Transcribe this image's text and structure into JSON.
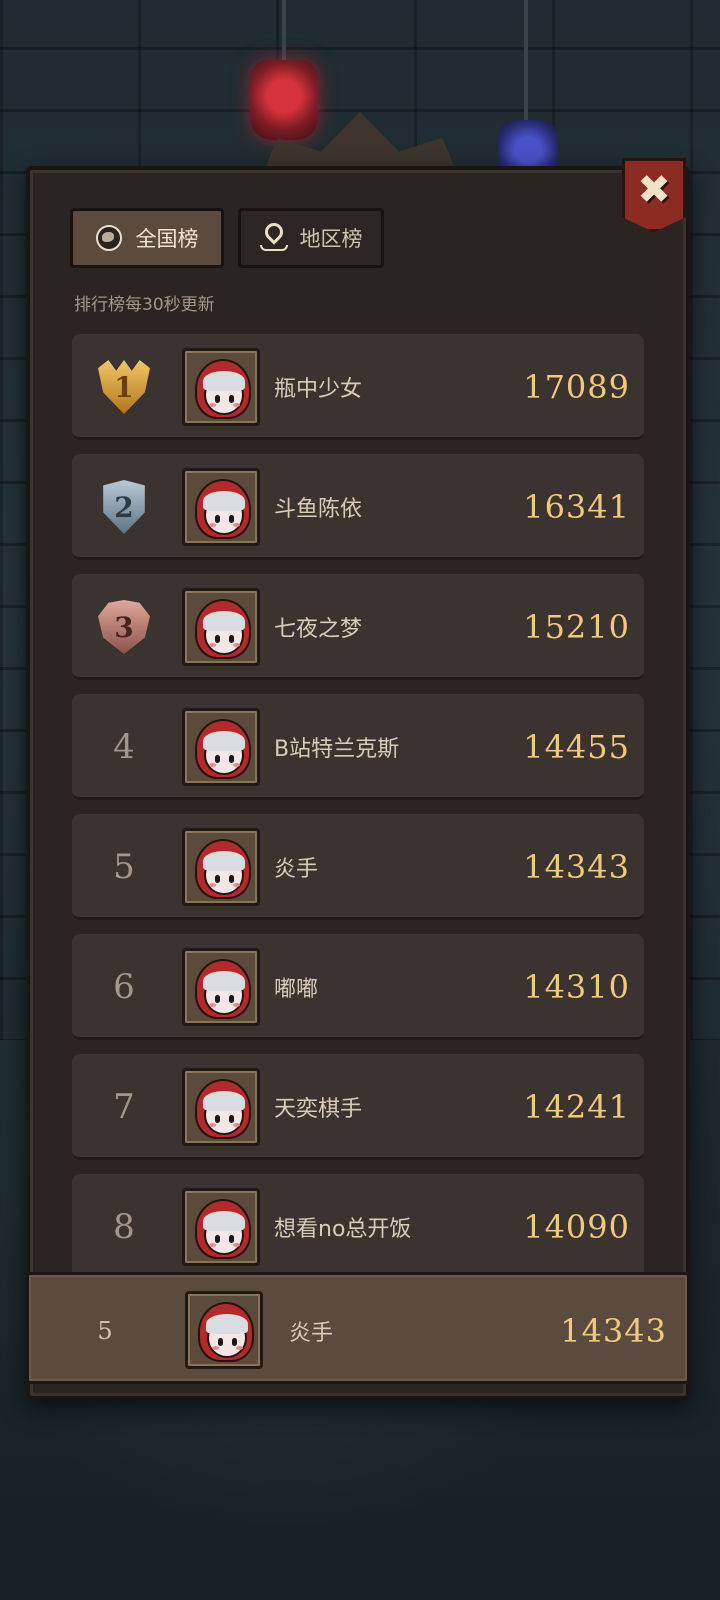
{
  "tabs": {
    "national": "全国榜",
    "region": "地区榜"
  },
  "refresh_note": "排行榜每30秒更新",
  "close_icon": "✖",
  "leaderboard": [
    {
      "rank": "1",
      "name": "瓶中少女",
      "score": "17089",
      "medal": "gold"
    },
    {
      "rank": "2",
      "name": "斗鱼陈依",
      "score": "16341",
      "medal": "silver"
    },
    {
      "rank": "3",
      "name": "七夜之梦",
      "score": "15210",
      "medal": "bronze"
    },
    {
      "rank": "4",
      "name": "B站特兰克斯",
      "score": "14455"
    },
    {
      "rank": "5",
      "name": "炎手",
      "score": "14343"
    },
    {
      "rank": "6",
      "name": "嘟嘟",
      "score": "14310"
    },
    {
      "rank": "7",
      "name": "天奕棋手",
      "score": "14241"
    },
    {
      "rank": "8",
      "name": "想看no总开饭",
      "score": "14090"
    }
  ],
  "self": {
    "rank": "5",
    "name": "炎手",
    "score": "14343"
  },
  "colors": {
    "score": "#f0c97a",
    "panel": "#2a2522",
    "row": "#3a3330",
    "close_button": "#8c2b22"
  },
  "icons": {
    "national_tab": "globe-icon",
    "region_tab": "location-pin-icon",
    "close": "close-icon"
  }
}
